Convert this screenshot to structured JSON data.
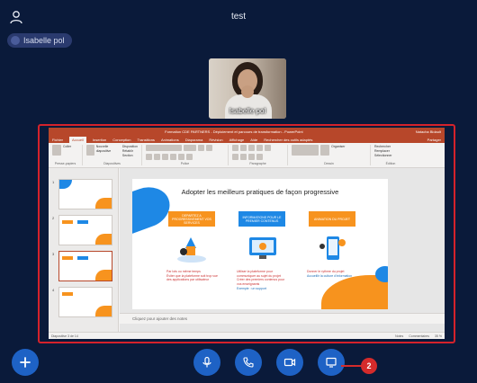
{
  "header": {
    "title": "test",
    "person_icon": "person-icon"
  },
  "participant_chip": {
    "name": "Isabelle pol"
  },
  "video_tile": {
    "name": "Isabelle pol"
  },
  "shared_screen": {
    "title_bar": "Formation CDE PARTNERS - Déploiement et parcours de transformation - PowerPoint",
    "user": "Natacha Bidault",
    "tabs": [
      "Fichier",
      "Accueil",
      "Insertion",
      "Conception",
      "Transitions",
      "Animations",
      "Diaporama",
      "Révision",
      "Affichage",
      "Aide",
      "Rechercher des outils adaptés"
    ],
    "share_label": "Partager",
    "ribbon_groups": [
      "Presse-papiers",
      "Diapositives",
      "Police",
      "Paragraphe",
      "Dessin",
      "Édition"
    ],
    "ribbon_labels": {
      "coller": "Coller",
      "nouvelle": "Nouvelle diapositive",
      "disposition": "Disposition",
      "retablir": "Rétablir",
      "section": "Section",
      "organiser": "Organiser",
      "rechercher": "Rechercher",
      "remplacer": "Remplacer",
      "selectionner": "Sélectionner"
    },
    "thumb_numbers": [
      "1",
      "2",
      "3",
      "4"
    ],
    "slide": {
      "title": "Adopter les meilleurs pratiques de façon progressive",
      "columns": [
        {
          "heading": "DEPARTEZ A PROGRESSIVEMENT VOS SERVICES",
          "lines": [
            "Par lots ou même temps",
            "Éviter que la plateforme soit trop vue des applications par utilisateur"
          ]
        },
        {
          "heading": "INFORMATIONS POUR LE PREMIER CONTENUS",
          "lines": [
            "Utiliser la plateforme pour communiquer au sujet du projet",
            "Créer des premiers contenus pour vos enseignants",
            "Exemple : un support"
          ]
        },
        {
          "heading": "ANIMATION DU PROJET",
          "lines": [
            "Donner le rythme du projet",
            "Accueillir la culture d'information"
          ]
        }
      ]
    },
    "notes_placeholder": "Cliquez pour ajouter des notes",
    "status": {
      "slide_count": "Diapositive 3 de 14",
      "notes": "Notes",
      "comments": "Commentaires",
      "zoom": "35 %"
    }
  },
  "controls": {
    "add": "plus-icon",
    "mic": "microphone-icon",
    "call": "phone-icon",
    "video": "video-camera-icon",
    "share": "screen-share-icon"
  },
  "badge": {
    "value": "2"
  },
  "colors": {
    "background": "#0a1a3a",
    "accent": "#1e62c5",
    "highlight": "#d5222b",
    "ppt": "#b7472a"
  }
}
